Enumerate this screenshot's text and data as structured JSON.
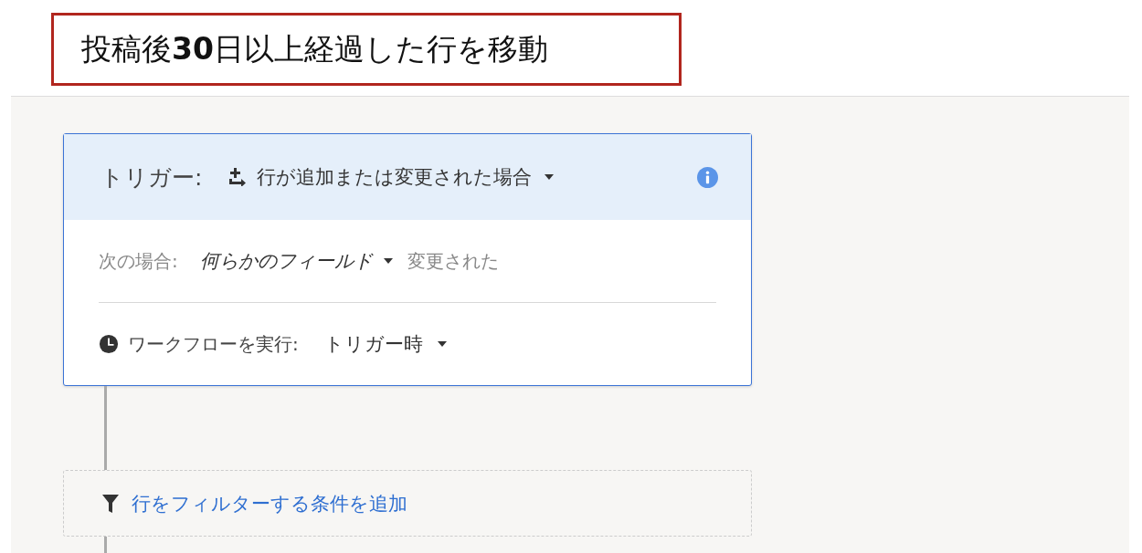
{
  "title": "投稿後**30**日以上経過した行を移動",
  "trigger": {
    "label": "トリガー:",
    "value": "行が追加または変更された場合",
    "condition_label": "次の場合:",
    "condition_field": "何らかのフィールド",
    "condition_text": "変更された",
    "run_label": "ワークフローを実行:",
    "run_value": "トリガー時"
  },
  "filter": {
    "link": "行をフィルターする条件を追加"
  }
}
